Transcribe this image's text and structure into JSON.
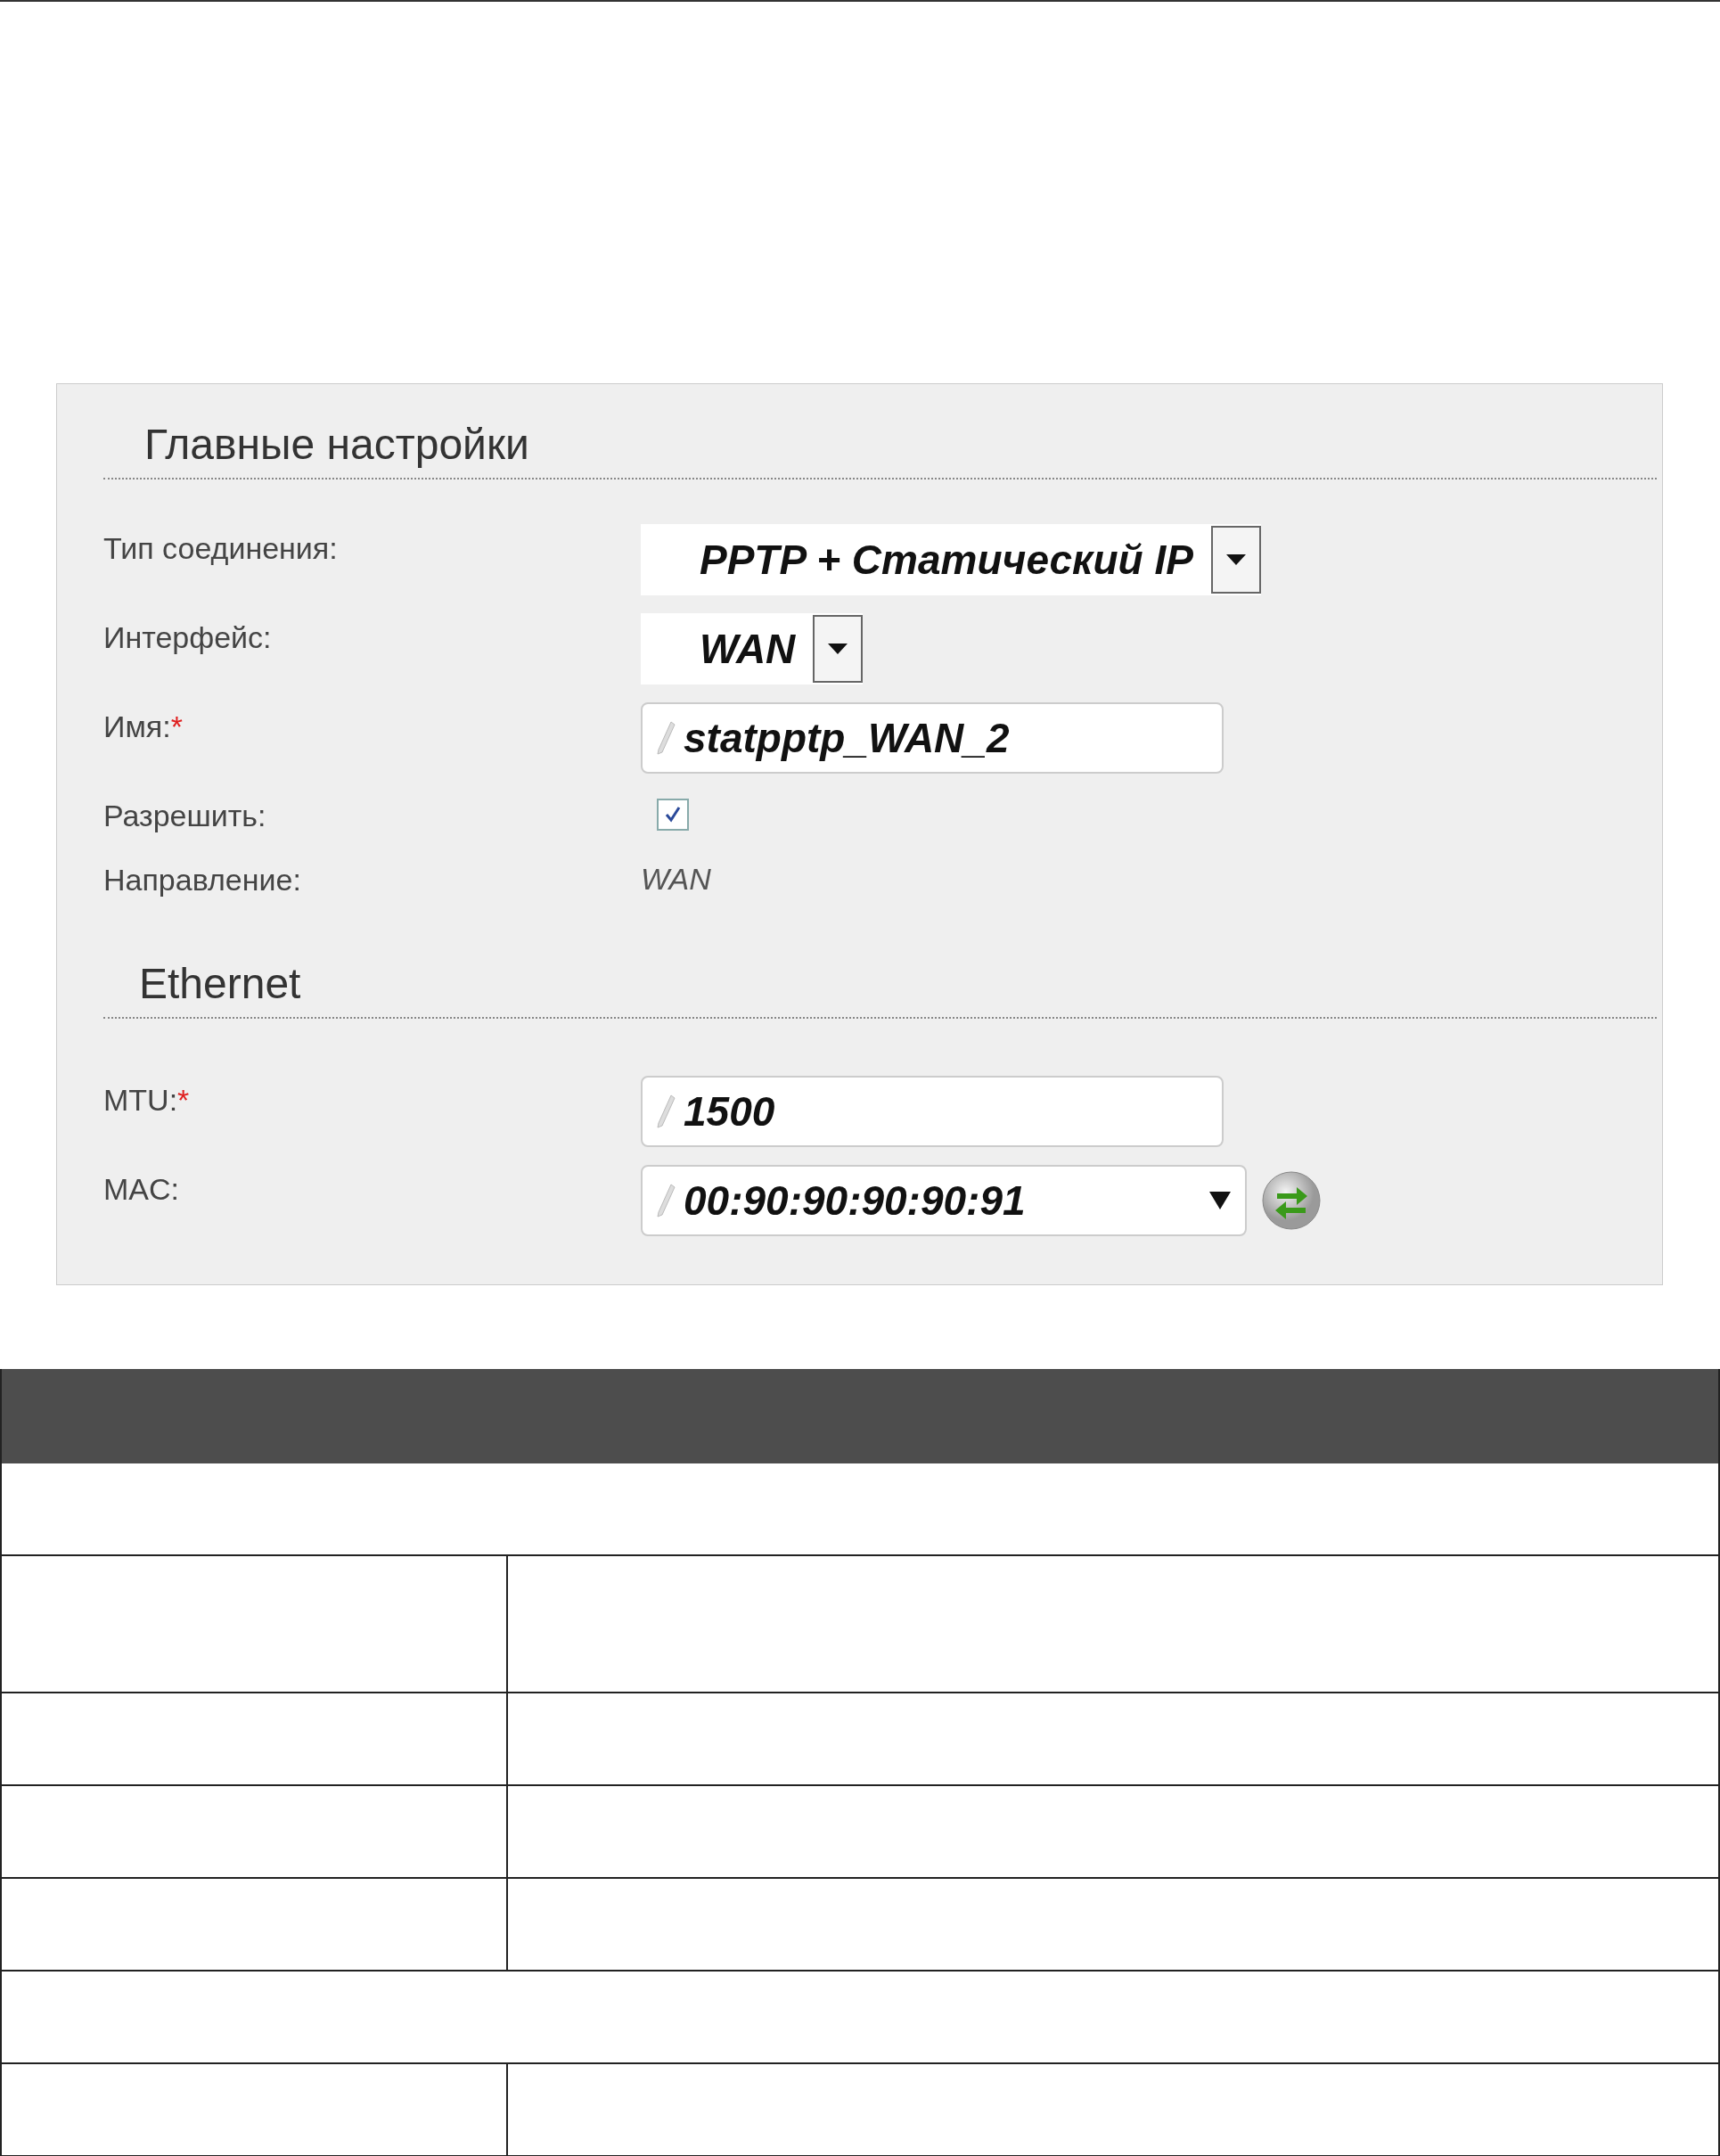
{
  "panel": {
    "sections": [
      {
        "title": "Главные настройки",
        "fields": [
          {
            "kind": "select",
            "label": "Тип соединения:",
            "value": "PPTP + Статический IP"
          },
          {
            "kind": "select",
            "label": "Интерфейс:",
            "value": "WAN"
          },
          {
            "kind": "input",
            "label": "Имя:",
            "required_mark": "*",
            "value": "statpptp_WAN_2"
          },
          {
            "kind": "checkbox",
            "label": "Разрешить:",
            "checked": true
          },
          {
            "kind": "text",
            "label": "Направление:",
            "value": "WAN"
          }
        ]
      },
      {
        "title": "Ethernet",
        "fields": [
          {
            "kind": "input",
            "label": "MTU:",
            "required_mark": "*",
            "value": "1500"
          },
          {
            "kind": "combo",
            "label": "MAC:",
            "value": "00:90:90:90:90:91"
          }
        ]
      }
    ]
  },
  "table": {
    "rows": [
      {
        "kind": "span"
      },
      {
        "kind": "tall"
      },
      {
        "kind": "split"
      },
      {
        "kind": "split"
      },
      {
        "kind": "split"
      },
      {
        "kind": "span"
      },
      {
        "kind": "split"
      }
    ]
  }
}
